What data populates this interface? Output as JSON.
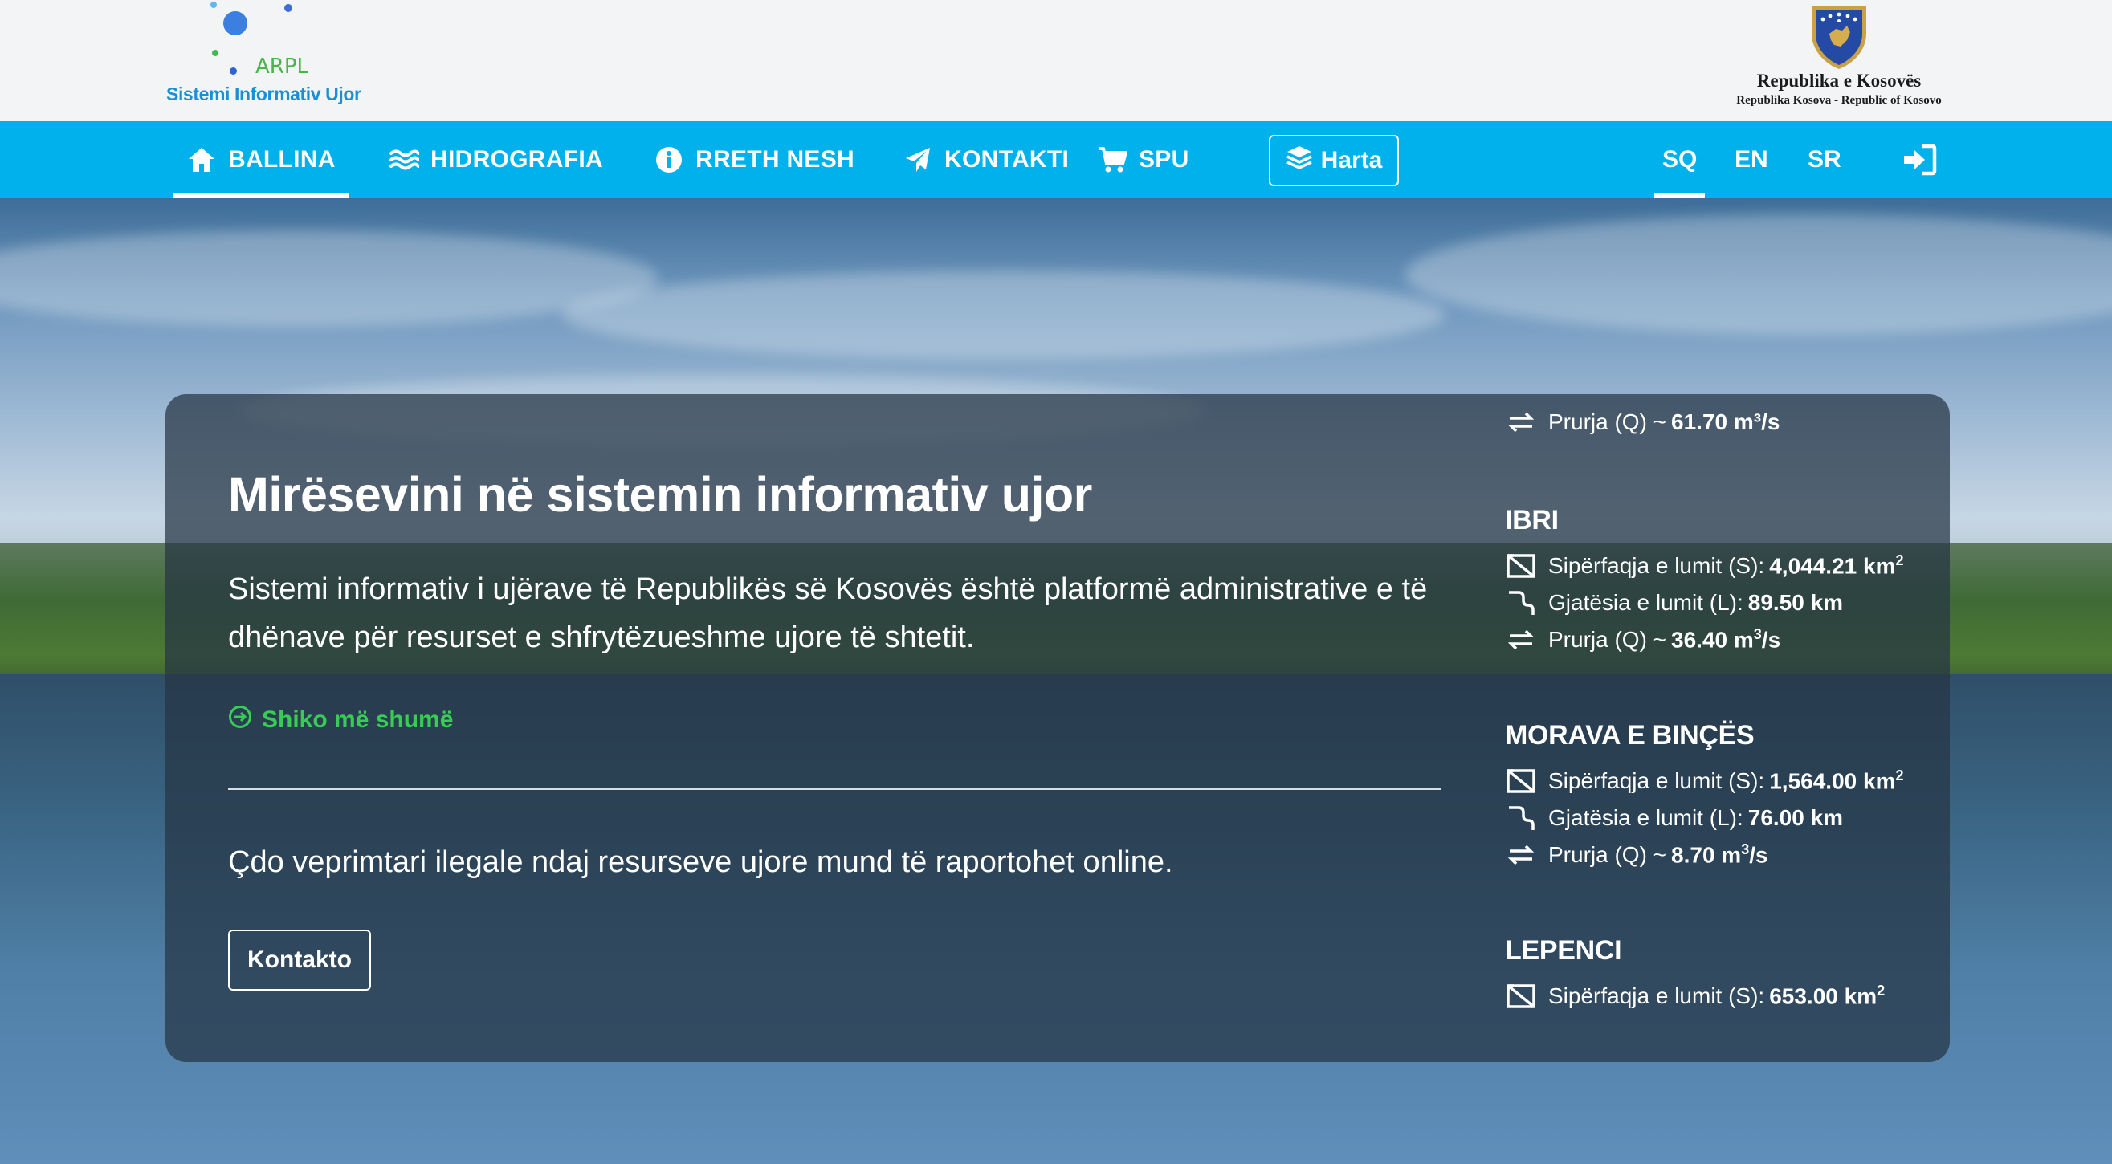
{
  "header": {
    "logo_abbr": "ARPL",
    "logo_name": "Sistemi Informativ Ujor",
    "gov_title": "Republika e Kosovës",
    "gov_subtitle": "Republika Kosova - Republic of Kosovo"
  },
  "nav": {
    "items": [
      {
        "label": "BALLINA",
        "icon": "home-icon"
      },
      {
        "label": "HIDROGRAFIA",
        "icon": "waves-icon"
      },
      {
        "label": "RRETH NESH",
        "icon": "info-icon"
      },
      {
        "label": "KONTAKTI",
        "icon": "paper-plane-icon"
      },
      {
        "label": "SPU",
        "icon": "cart-icon"
      }
    ],
    "map_button": "Harta",
    "languages": [
      "SQ",
      "EN",
      "SR"
    ],
    "active_language": "SQ"
  },
  "hero": {
    "title": "Mirësevini në sistemin informativ ujor",
    "description": "Sistemi informativ i ujërave të Republikës së Kosovës është platformë administrative e të dhënave për resurset e shfrytëzueshme ujore të shtetit.",
    "more_link": "Shiko më shumë",
    "report_text": "Çdo veprimtari ilegale ndaj resurseve ujore mund të raportohet online.",
    "contact_button": "Kontakto"
  },
  "rivers": {
    "area_label": "Sipërfaqja e lumit (S):",
    "length_label": "Gjatësia e lumit (L):",
    "flow_label": "Prurja (Q) ~",
    "partial_flow_value": "61.70 m³/s",
    "items": [
      {
        "name": "IBRI",
        "area": "4,044.21 km",
        "length": "89.50 km",
        "flow": "36.40 m"
      },
      {
        "name": "MORAVA E BINÇËS",
        "area": "1,564.00 km",
        "length": "76.00 km",
        "flow": "8.70 m"
      },
      {
        "name": "LEPENCI",
        "area": "653.00 km"
      }
    ],
    "area_unit_sup": "2",
    "flow_unit_sup": "3",
    "flow_unit_suffix": "/s"
  }
}
